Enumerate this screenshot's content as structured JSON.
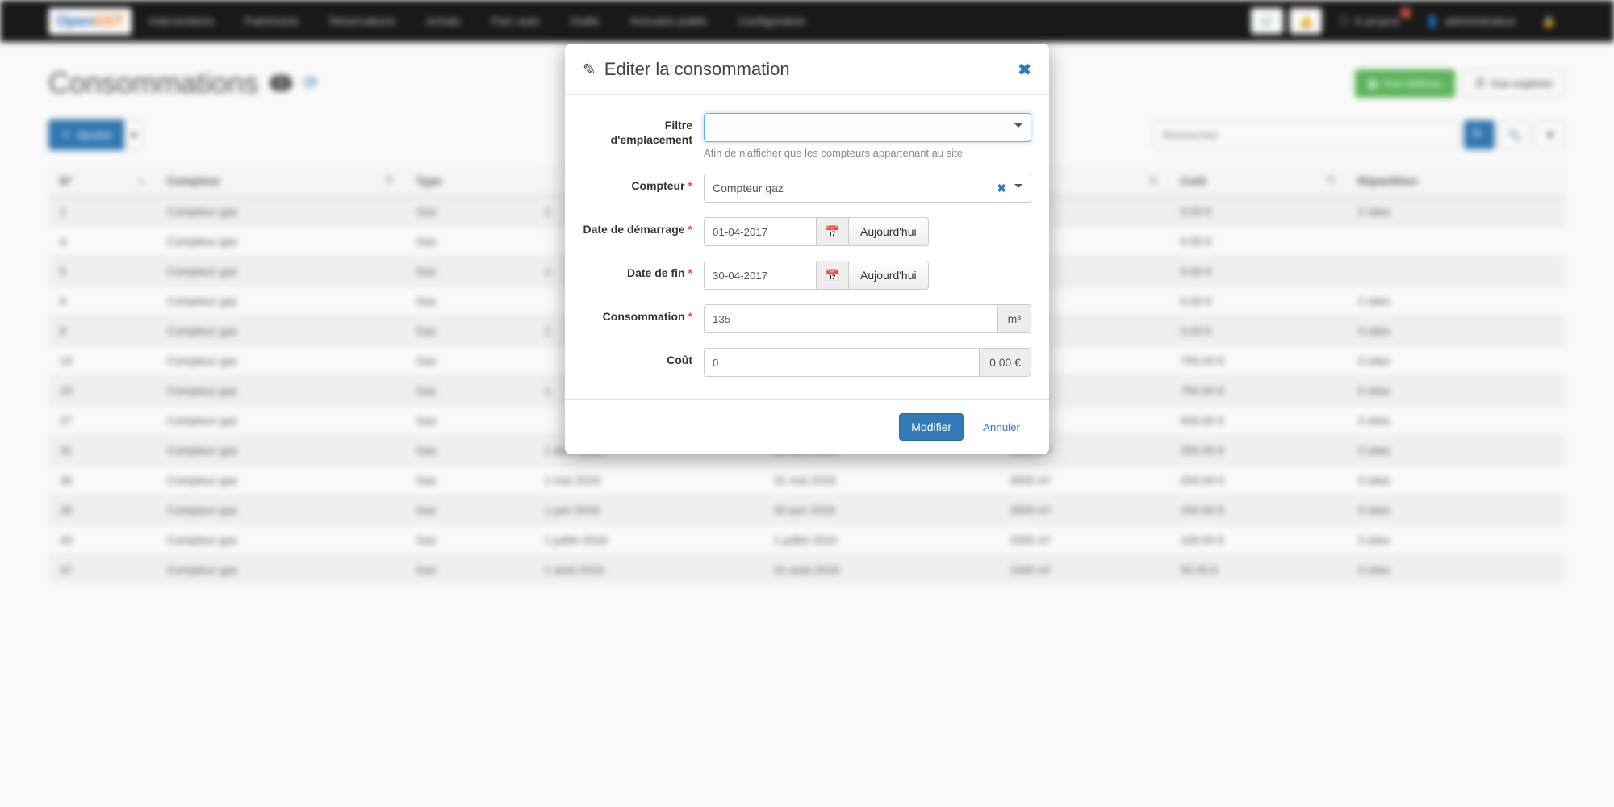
{
  "brand": {
    "part1": "Open",
    "part2": "GST"
  },
  "nav": {
    "items": [
      "Interventions",
      "Patrimoine",
      "Réservations",
      "Achats",
      "Parc auto",
      "Outils",
      "Annuaire public",
      "Configuration"
    ],
    "about": "À propos",
    "user": "administrateur"
  },
  "page": {
    "title": "Consommations",
    "count": "5",
    "btn_table": "Vue tableau",
    "btn_explore": "Vue explorer",
    "btn_add": "Ajouter",
    "search_placeholder": "Rechercher"
  },
  "table": {
    "headers": [
      "N°",
      "Compteur",
      "Type",
      "",
      "",
      "",
      "Coût",
      "Répartition"
    ],
    "rows": [
      {
        "n": "1",
        "compteur": "Compteur gaz",
        "type": "Gaz",
        "d1": "1",
        "d2": "",
        "v": "",
        "cout": "0.00 €",
        "rep": "2 sites"
      },
      {
        "n": "4",
        "compteur": "Compteur gaz",
        "type": "Gaz",
        "d1": "",
        "d2": "",
        "v": "",
        "cout": "0.00 €",
        "rep": ""
      },
      {
        "n": "5",
        "compteur": "Compteur gaz",
        "type": "Gaz",
        "d1": "1",
        "d2": "",
        "v": "",
        "cout": "0.00 €",
        "rep": ""
      },
      {
        "n": "6",
        "compteur": "Compteur gaz",
        "type": "Gaz",
        "d1": "",
        "d2": "",
        "v": "",
        "cout": "0.00 €",
        "rep": "2 sites"
      },
      {
        "n": "9",
        "compteur": "Compteur gaz",
        "type": "Gaz",
        "d1": "1",
        "d2": "",
        "v": "",
        "cout": "0.00 €",
        "rep": "3 sites"
      },
      {
        "n": "19",
        "compteur": "Compteur gaz",
        "type": "Gaz",
        "d1": "",
        "d2": "",
        "v": "",
        "cout": "755.00 €",
        "rep": "3 sites"
      },
      {
        "n": "23",
        "compteur": "Compteur gaz",
        "type": "Gaz",
        "d1": "1",
        "d2": "",
        "v": "",
        "cout": "750.00 €",
        "rep": "3 sites"
      },
      {
        "n": "27",
        "compteur": "Compteur gaz",
        "type": "Gaz",
        "d1": "",
        "d2": "",
        "v": "",
        "cout": "500.00 €",
        "rep": "3 sites"
      },
      {
        "n": "31",
        "compteur": "Compteur gaz",
        "type": "Gaz",
        "d1": "1 avril 2016",
        "d2": "30 avril 2016",
        "v": "5000 m³",
        "cout": "250.00 €",
        "rep": "3 sites"
      },
      {
        "n": "35",
        "compteur": "Compteur gaz",
        "type": "Gaz",
        "d1": "1 mai 2016",
        "d2": "31 mai 2016",
        "v": "4000 m³",
        "cout": "200.00 €",
        "rep": "3 sites"
      },
      {
        "n": "39",
        "compteur": "Compteur gaz",
        "type": "Gaz",
        "d1": "1 juin 2016",
        "d2": "30 juin 2016",
        "v": "3000 m³",
        "cout": "150.00 €",
        "rep": "3 sites"
      },
      {
        "n": "43",
        "compteur": "Compteur gaz",
        "type": "Gaz",
        "d1": "1 juillet 2016",
        "d2": "1 juillet 2016",
        "v": "2000 m³",
        "cout": "100.00 €",
        "rep": "3 sites"
      },
      {
        "n": "47",
        "compteur": "Compteur gaz",
        "type": "Gaz",
        "d1": "1 août 2016",
        "d2": "31 août 2016",
        "v": "1000 m³",
        "cout": "50.00 €",
        "rep": "3 sites"
      }
    ]
  },
  "modal": {
    "title": "Editer la consommation",
    "labels": {
      "filter": "Filtre d'emplacement",
      "compteur": "Compteur",
      "date_start": "Date de démarrage",
      "date_end": "Date de fin",
      "conso": "Consommation",
      "cost": "Coût"
    },
    "help_filter": "Afin de n'afficher que les compteurs appartenant au site",
    "values": {
      "filter": "",
      "compteur": "Compteur gaz",
      "date_start": "01-04-2017",
      "date_end": "30-04-2017",
      "conso": "135",
      "conso_unit": "m³",
      "cost": "0",
      "cost_suffix": "0.00 €"
    },
    "btn_today": "Aujourd'hui",
    "btn_submit": "Modifier",
    "btn_cancel": "Annuler"
  }
}
